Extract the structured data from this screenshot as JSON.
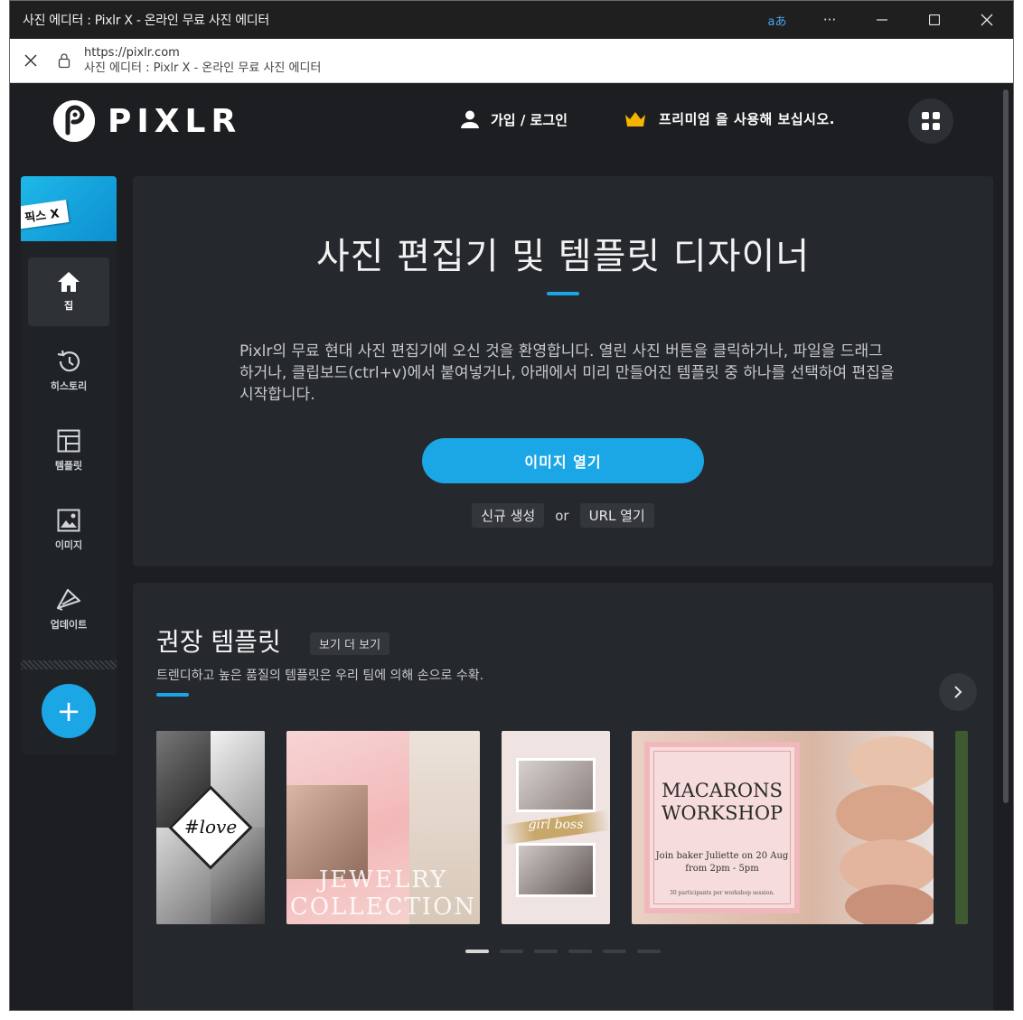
{
  "window": {
    "title": "사진 에디터 : Pixlr X - 온라인 무료 사진 에디터",
    "translate_label": "aあ",
    "more_label": "···"
  },
  "address": {
    "url": "https://pixlr.com",
    "page_title": "사진 에디터 : Pixlr X - 온라인 무료 사진 에디터"
  },
  "header": {
    "logo_text": "PIXLR",
    "login_label": "가입 / 로그인",
    "premium_label": "프리미엄 을 사용해 보십시오."
  },
  "sidebar": {
    "badge_label": "픽스 X",
    "items": [
      {
        "label": "집",
        "icon": "home-icon",
        "active": true
      },
      {
        "label": "히스토리",
        "icon": "history-icon",
        "active": false
      },
      {
        "label": "템플릿",
        "icon": "template-icon",
        "active": false
      },
      {
        "label": "이미지",
        "icon": "image-icon",
        "active": false
      },
      {
        "label": "업데이트",
        "icon": "update-icon",
        "active": false
      }
    ],
    "add_label": "+"
  },
  "welcome": {
    "title": "사진 편집기 및 템플릿 디자이너",
    "description": "Pixlr의 무료 현대 사진 편집기에 오신 것을 환영합니다. 열린 사진 버튼을 클릭하거나, 파일을 드래그하거나, 클립보드(ctrl+v)에서 붙여넣거나, 아래에서 미리 만들어진 템플릿 중 하나를 선택하여 편집을 시작합니다.",
    "open_image_label": "이미지 열기",
    "new_label": "신규 생성",
    "or_label": "or",
    "url_label": "URL 열기"
  },
  "templates": {
    "title": "권장 템플릿",
    "see_more_label": "보기 더 보기",
    "subtitle": "트렌디하고 높은 품질의 템플릿은 우리 팀에 의해 손으로 수확.",
    "items": [
      {
        "text": "#love"
      },
      {
        "text": "JEWELRY COLLECTION"
      },
      {
        "text": "girl boss"
      },
      {
        "title": "MACARONS WORKSHOP",
        "sub": "Join baker Juliette on 20 Aug from 2pm - 5pm",
        "small": "30 participants per workshop session."
      }
    ],
    "pages": 6,
    "active_page": 1
  },
  "colors": {
    "accent": "#1ba6e6",
    "background": "#1c1e21",
    "panel": "#25282c",
    "crown": "#f5b400"
  }
}
